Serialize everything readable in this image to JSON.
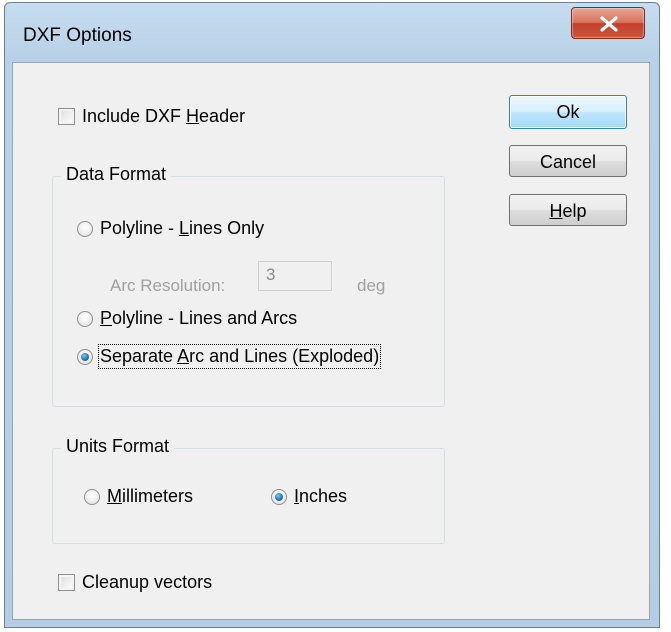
{
  "window": {
    "title": "DXF Options"
  },
  "include_header": {
    "pre": "Include DXF ",
    "mnemonic": "H",
    "post": "eader",
    "checked": false
  },
  "data_format": {
    "title": "Data Format",
    "lines_only": {
      "pre": "Polyline - ",
      "mnemonic": "L",
      "post": "ines Only",
      "selected": false
    },
    "arc_resolution": {
      "label": "Arc Resolution:",
      "value": "3",
      "unit": "deg"
    },
    "lines_and_arcs": {
      "pre": "",
      "mnemonic": "P",
      "post": "olyline - Lines and Arcs",
      "selected": false
    },
    "exploded": {
      "pre": "Separate ",
      "mnemonic": "A",
      "post": "rc and Lines (Exploded)",
      "selected": true
    }
  },
  "units_format": {
    "title": "Units Format",
    "millimeters": {
      "pre": "",
      "mnemonic": "M",
      "post": "illimeters",
      "selected": false
    },
    "inches": {
      "pre": "",
      "mnemonic": "I",
      "post": "nches",
      "selected": true
    }
  },
  "cleanup": {
    "label": "Cleanup vectors",
    "checked": false
  },
  "buttons": {
    "ok": "Ok",
    "cancel": "Cancel",
    "help": {
      "pre": "",
      "mnemonic": "H",
      "post": "elp"
    }
  },
  "colors": {
    "accent": "#3c7fb1",
    "close": "#c4402a",
    "frame": "#b9d1e8",
    "face": "#f0f0f0"
  },
  "icons": {
    "close": "close-x-icon"
  }
}
